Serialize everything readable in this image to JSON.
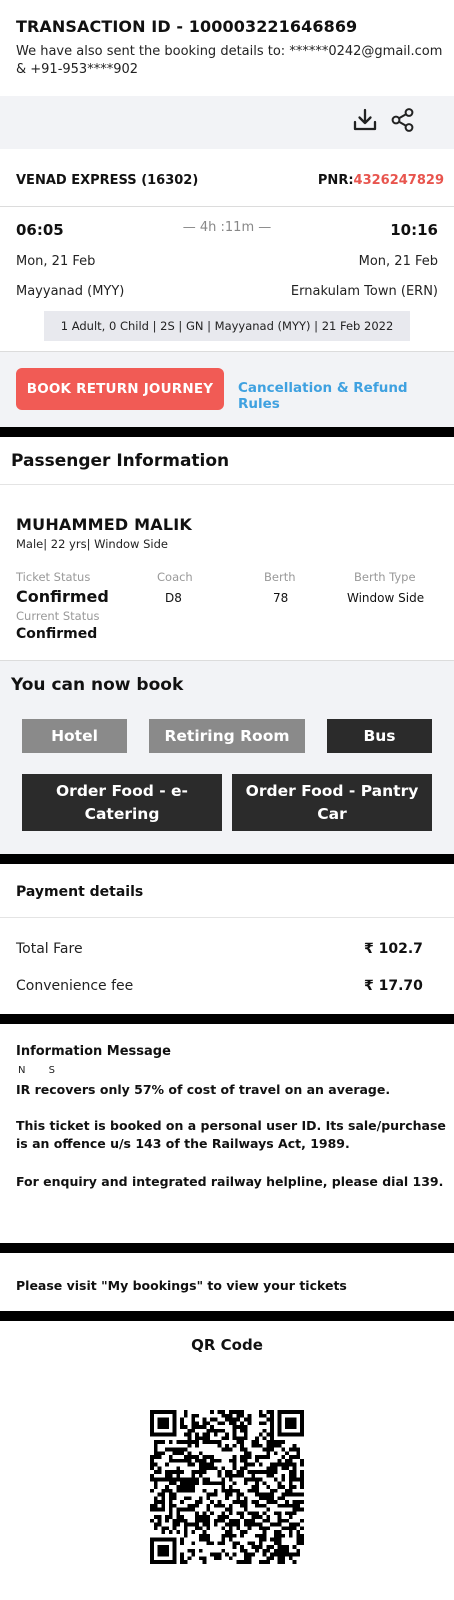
{
  "header": {
    "transaction_title": "TRANSACTION ID - 100003221646869",
    "booking_note": "We have also sent the booking details to: ******0242@gmail.com & +91-953****902"
  },
  "actions": {
    "download_icon": "download-icon",
    "share_icon": "share-icon"
  },
  "train": {
    "name": "VENAD EXPRESS (16302)",
    "pnr_label": "PNR:",
    "pnr_value": "4326247829",
    "departure_time": "06:05",
    "arrival_time": "10:16",
    "duration": "— 4h :11m —",
    "departure_date": "Mon, 21 Feb",
    "arrival_date": "Mon, 21 Feb",
    "departure_station": "Mayyanad (MYY)",
    "arrival_station": "Ernakulam Town (ERN)",
    "booking_summary": "1 Adult, 0 Child | 2S | GN | Mayyanad (MYY) | 21 Feb 2022"
  },
  "journey_actions": {
    "book_return": "BOOK RETURN JOURNEY",
    "cancellation_rules": "Cancellation & Refund Rules"
  },
  "passenger": {
    "heading": "Passenger Information",
    "name": "MUHAMMED MALIK",
    "meta": "Male| 22 yrs| Window Side",
    "ticket_status_label": "Ticket Status",
    "ticket_status": "Confirmed",
    "current_status_label": "Current Status",
    "current_status": "Confirmed",
    "coach_label": "Coach",
    "coach": "D8",
    "berth_label": "Berth",
    "berth": "78",
    "berth_type_label": "Berth Type",
    "berth_type": "Window Side"
  },
  "book_more": {
    "heading": "You can now book",
    "hotel": "Hotel",
    "retiring_room": "Retiring Room",
    "bus": "Bus",
    "food_ecatering": "Order Food - e-Catering",
    "food_pantry": "Order Food - Pantry Car"
  },
  "payment": {
    "heading": "Payment details",
    "total_fare_label": "Total Fare",
    "total_fare": "₹  102.7",
    "convenience_fee_label": "Convenience fee",
    "convenience_fee": "₹  17.70"
  },
  "info": {
    "heading": "Information Message",
    "ns": "N S",
    "line1": "IR recovers only 57% of cost of travel on an average.",
    "line2": "This ticket is booked on a personal user ID. Its sale/purchase is an offence u/s 143 of the Railways Act, 1989.",
    "line3": "For enquiry and integrated railway helpline, please dial 139."
  },
  "my_bookings_note": "Please visit \"My bookings\" to view your tickets",
  "qr": {
    "heading": "QR Code"
  },
  "colors": {
    "accent_red": "#f15b55",
    "link_blue": "#3fa1e0",
    "pnr_red": "#e8554e",
    "band_grey": "#f2f3f6"
  }
}
